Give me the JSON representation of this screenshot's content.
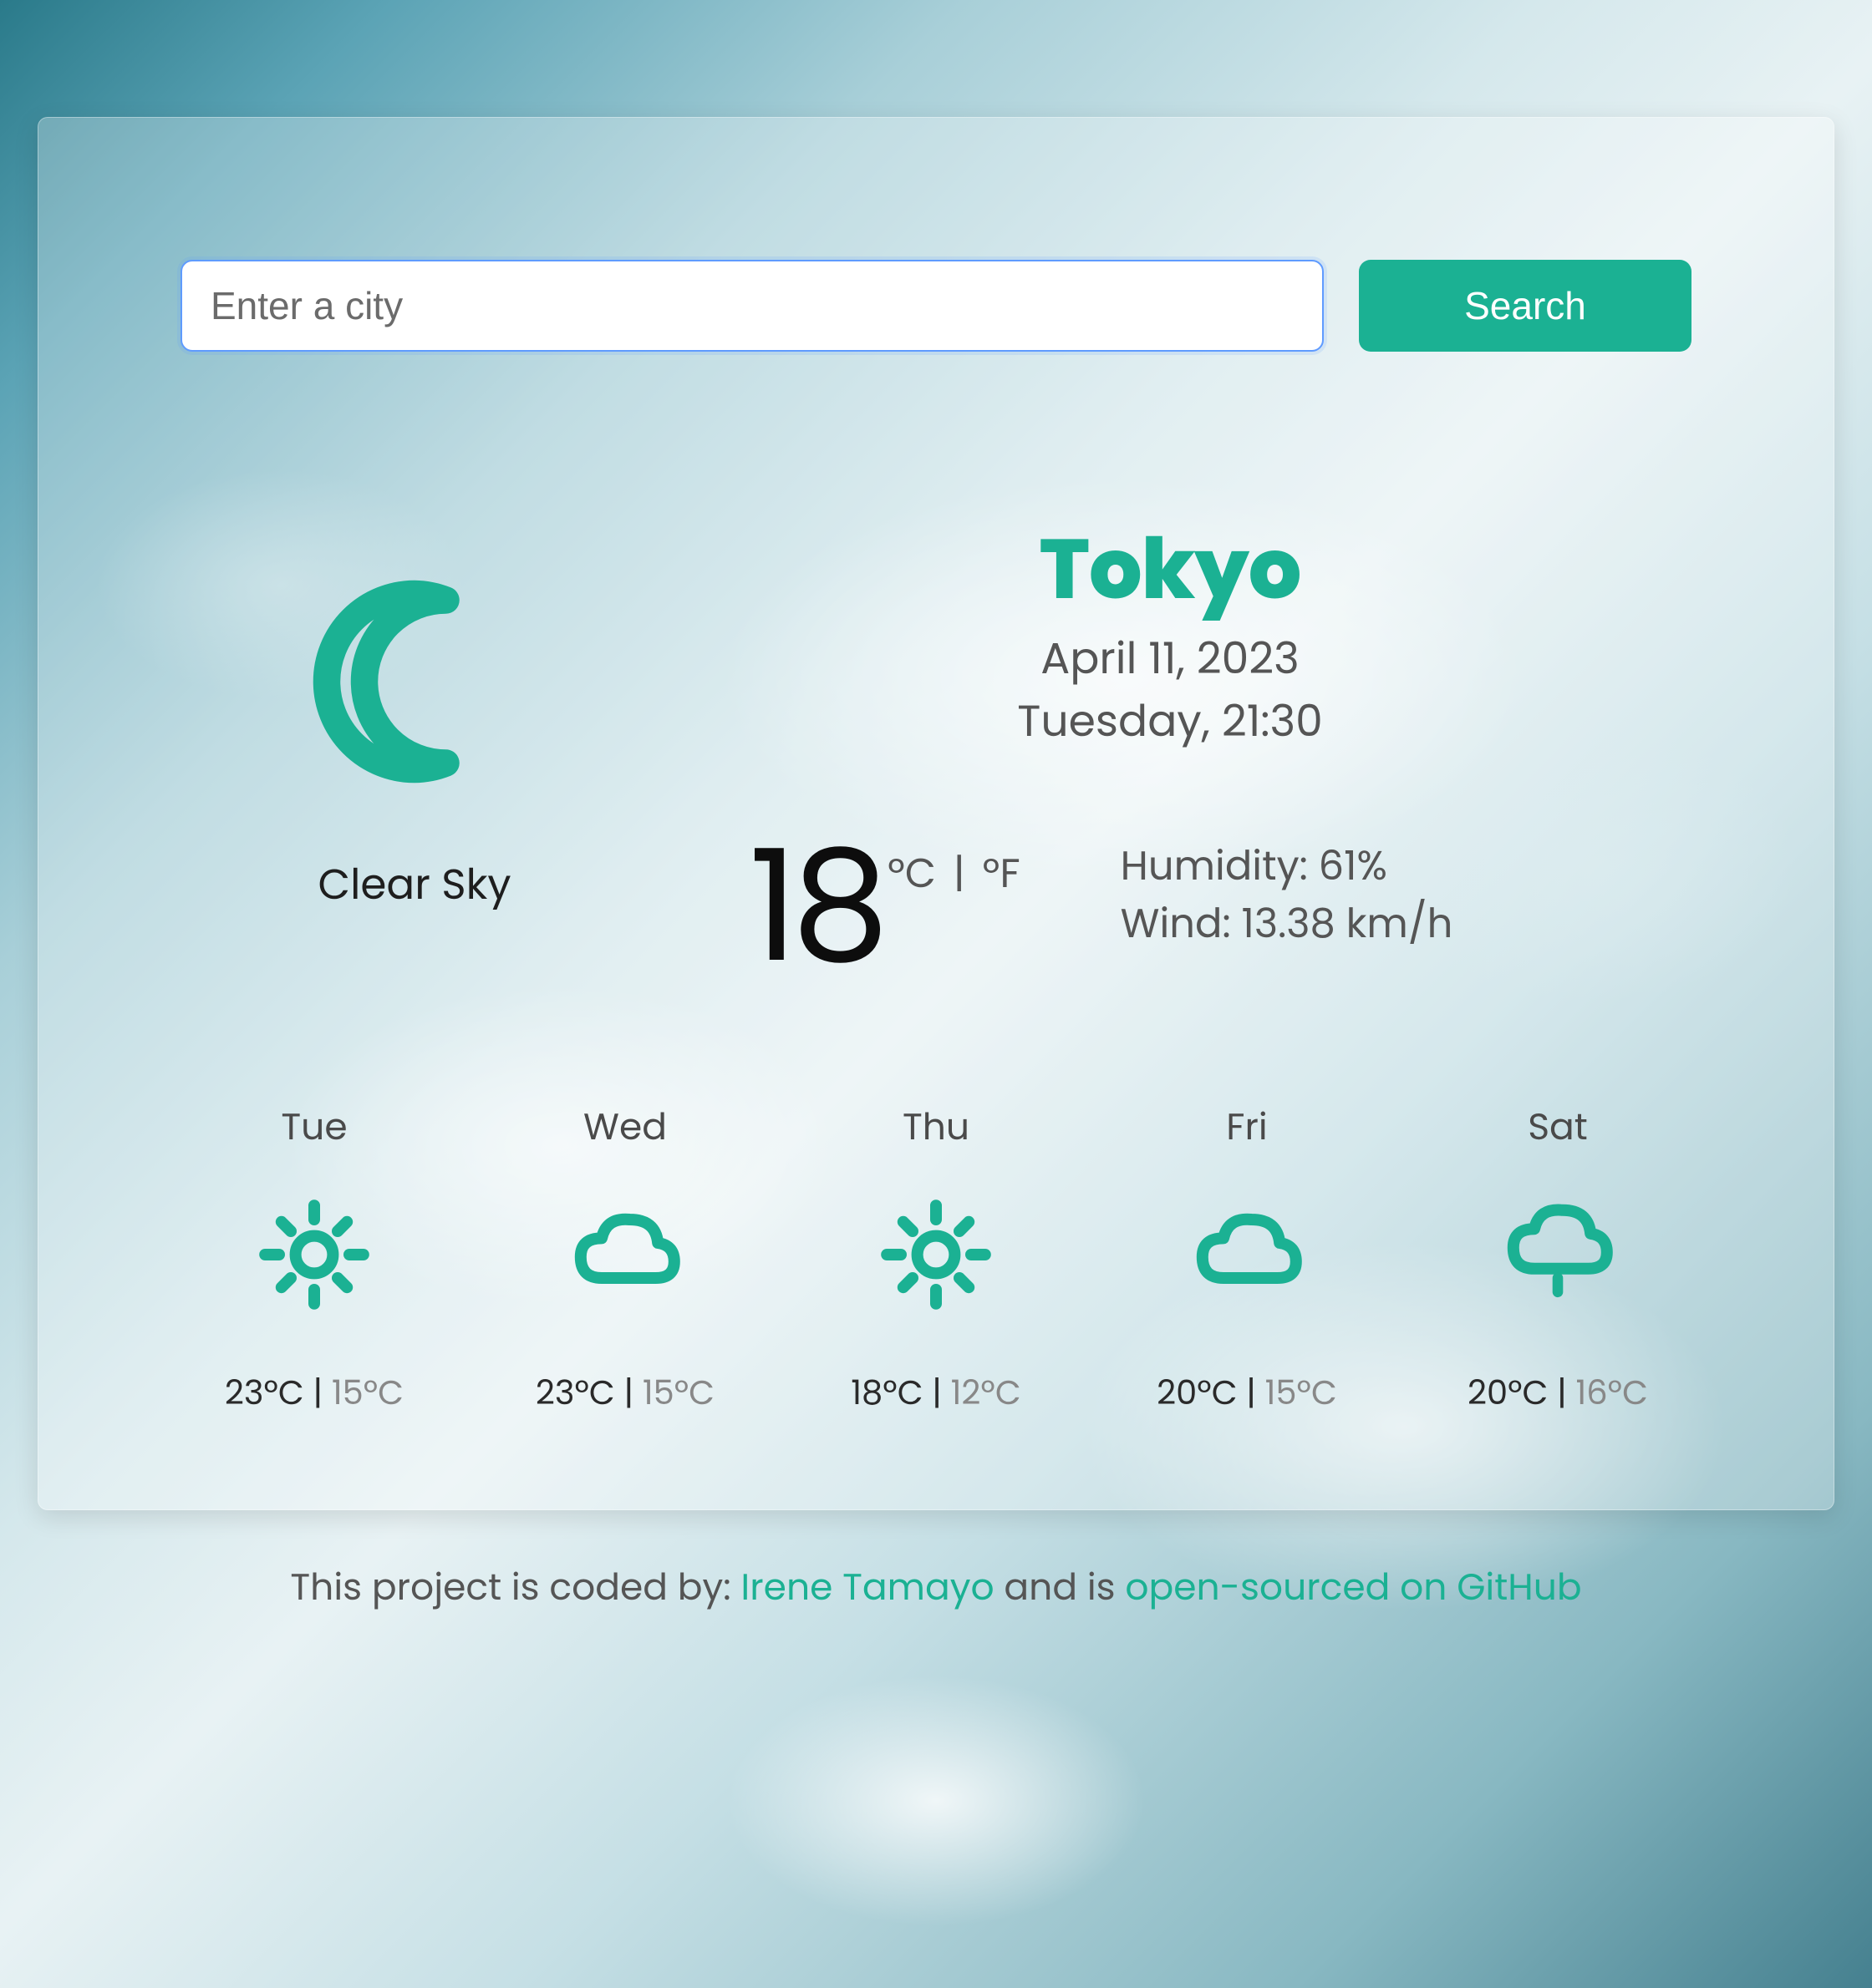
{
  "colors": {
    "accent": "#1bb193",
    "text_muted": "#555555"
  },
  "search": {
    "placeholder": "Enter a city",
    "button_label": "Search"
  },
  "current": {
    "icon": "moon",
    "description": "Clear Sky",
    "city": "Tokyo",
    "date": "April 11, 2023",
    "day_time": "Tuesday, 21:30",
    "temperature": "18",
    "unit_c": "ºC",
    "unit_separator": " | ",
    "unit_f": "ºF",
    "humidity_label": "Humidity: ",
    "humidity_value": "61%",
    "wind_label": "Wind: ",
    "wind_value": "13.38 km/h"
  },
  "forecast": [
    {
      "day": "Tue",
      "icon": "sun",
      "high": "23ºC",
      "low": "15ºC"
    },
    {
      "day": "Wed",
      "icon": "cloud",
      "high": "23ºC",
      "low": "15ºC"
    },
    {
      "day": "Thu",
      "icon": "sun",
      "high": "18ºC",
      "low": "12ºC"
    },
    {
      "day": "Fri",
      "icon": "cloud",
      "high": "20ºC",
      "low": "15ºC"
    },
    {
      "day": "Sat",
      "icon": "rain",
      "high": "20ºC",
      "low": "16ºC"
    }
  ],
  "footer": {
    "prefix": "This project is coded by: ",
    "author": "Irene Tamayo",
    "middle": " and is ",
    "repo_text": "open-sourced on GitHub"
  }
}
